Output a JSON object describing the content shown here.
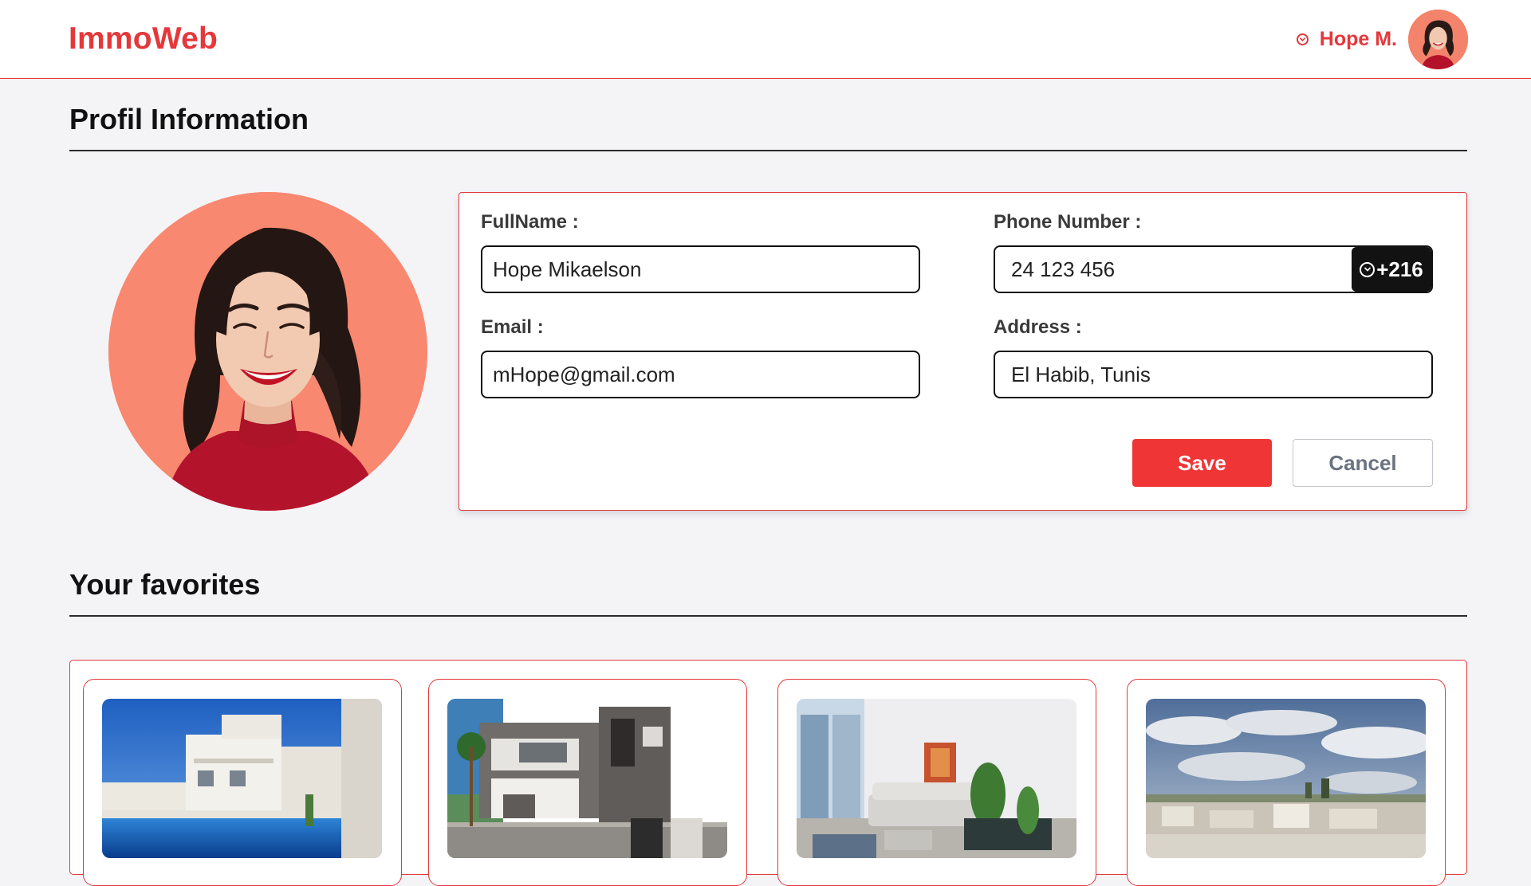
{
  "header": {
    "logo": "ImmoWeb",
    "user_name": "Hope M.",
    "user_menu_icon": "chevron-down-circle-icon",
    "avatar": "user-avatar"
  },
  "profile": {
    "title": "Profil Information",
    "fields": {
      "fullname": {
        "label": "FullName :",
        "value": "Hope Mikaelson"
      },
      "phone": {
        "label": "Phone Number :",
        "value": "24 123 456",
        "country_code": "+216"
      },
      "email": {
        "label": "Email :",
        "value": "mHope@gmail.com"
      },
      "address": {
        "label": "Address :",
        "value": "El Habib, Tunis"
      }
    },
    "save_label": "Save",
    "cancel_label": "Cancel"
  },
  "favorites": {
    "title": "Your favorites",
    "items": [
      {
        "photo": "villa-with-pool"
      },
      {
        "photo": "modern-house-facade"
      },
      {
        "photo": "living-room-interior"
      },
      {
        "photo": "city-rooftop-view"
      }
    ]
  },
  "colors": {
    "accent": "#e5383b",
    "save_button": "#ef3535",
    "background": "#f4f4f7",
    "avatar_bg": "#f98870"
  }
}
